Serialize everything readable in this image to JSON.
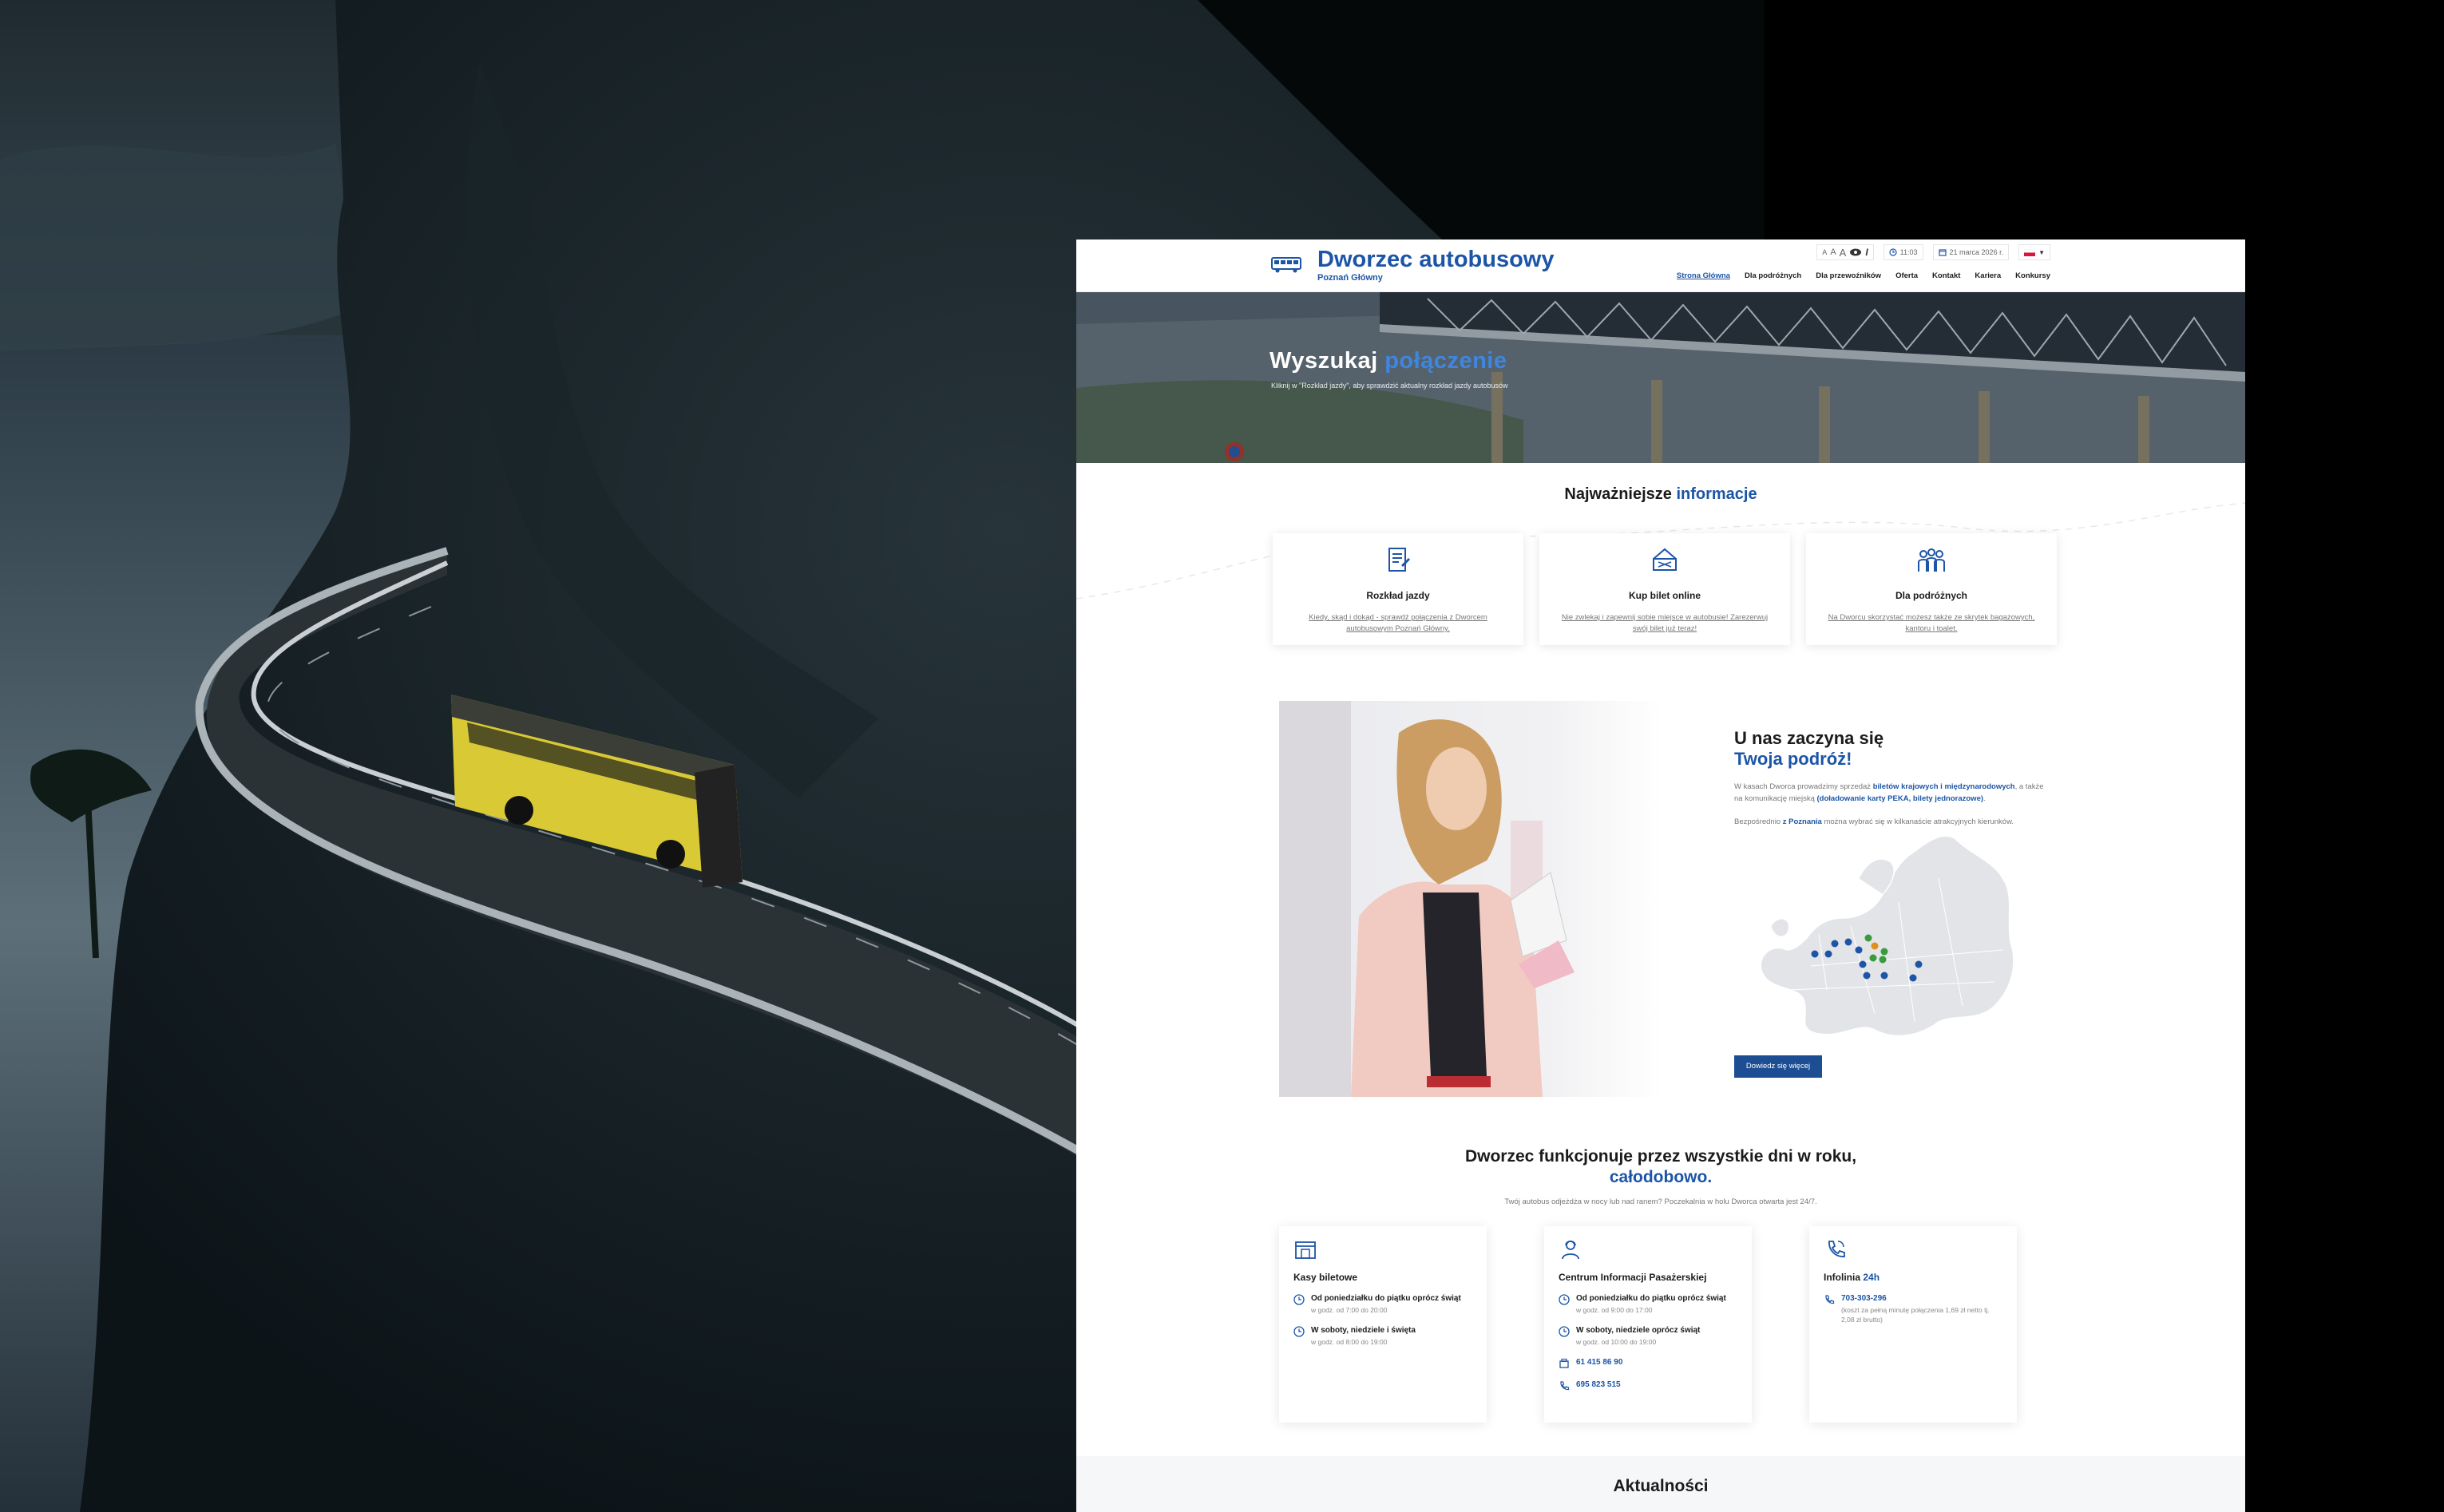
{
  "header": {
    "logo_title": "Dworzec autobusowy",
    "logo_subtitle": "Poznań Główny",
    "font_sizes": [
      "A",
      "A",
      "A"
    ],
    "time": "11:03",
    "date": "21 marca 2026 r.",
    "nav": [
      "Strona Główna",
      "Dla podróżnych",
      "Dla przewoźników",
      "Oferta",
      "Kontakt",
      "Kariera",
      "Konkursy"
    ]
  },
  "hero": {
    "title_main": "Wyszukaj ",
    "title_accent": "połączenie",
    "subtitle": "Kliknij w \"Rozkład jazdy\", aby sprawdzić aktualny rozkład jazdy autobusów"
  },
  "info": {
    "title_main": "Najważniejsze ",
    "title_accent": "informacje",
    "cards": [
      {
        "title": "Rozkład jazdy",
        "text": "Kiedy, skąd i dokąd - sprawdź połączenia z Dworcem autobusowym Poznań Główny."
      },
      {
        "title": "Kup bilet online",
        "text": "Nie zwlekaj i zapewnij sobie miejsce w autobusie! Zarezerwuj swój bilet już teraz!"
      },
      {
        "title": "Dla podróżnych",
        "text": "Na Dworcu skorzystać możesz także ze skrytek bagażowych, kantoru i toalet."
      }
    ]
  },
  "promo": {
    "title_main": "U nas zaczyna się",
    "title_accent": "Twoja podróż!",
    "p1_a": "W kasach Dworca prowadzimy sprzedaż ",
    "p1_b": "biletów krajowych i międzynarodowych",
    "p1_c": ", a także na komunikację miejską ",
    "p1_d": "(doładowanie karty PEKA, bilety jednorazowe)",
    "p1_e": ".",
    "p2_a": "Bezpośrednio ",
    "p2_b": "z Poznania",
    "p2_c": " można wybrać się w kilkanaście atrakcyjnych kierunków.",
    "button": "Dowiedz się więcej"
  },
  "open": {
    "title_main": "Dworzec funkcjonuje przez wszystkie dni w roku,",
    "title_accent": "całodobowo.",
    "subtitle": "Twój autobus odjeżdża w nocy lub nad ranem? Poczekalnia w holu Dworca otwarta jest 24/7.",
    "cards": [
      {
        "title": "Kasy biletowe",
        "rows": [
          {
            "t1": "Od poniedziałku do piątku oprócz świąt",
            "t2": "w godz. od 7:00 do 20:00"
          },
          {
            "t1": "W soboty, niedziele i święta",
            "t2": "w godz. od 8:00 do 19:00"
          }
        ]
      },
      {
        "title": "Centrum Informacji Pasażerskiej",
        "rows": [
          {
            "t1": "Od poniedziałku do piątku oprócz świąt",
            "t2": "w godz. od 9:00 do 17:00"
          },
          {
            "t1": "W soboty, niedziele oprócz świąt",
            "t2": "w godz. od 10:00 do 19:00"
          }
        ],
        "fax": "61 415 86 90",
        "phone": "695 823 515"
      },
      {
        "title_main": "Infolinia ",
        "title_accent": "24h",
        "phone": "703-303-296",
        "note": "(koszt za pełną minutę połączenia 1,69 zł netto tj. 2,08 zł brutto)"
      }
    ]
  },
  "news": {
    "title": "Aktualności"
  },
  "colors": {
    "brand": "#1c55a7",
    "accent": "#3e86e0",
    "bus_yellow": "#e3d23a"
  }
}
